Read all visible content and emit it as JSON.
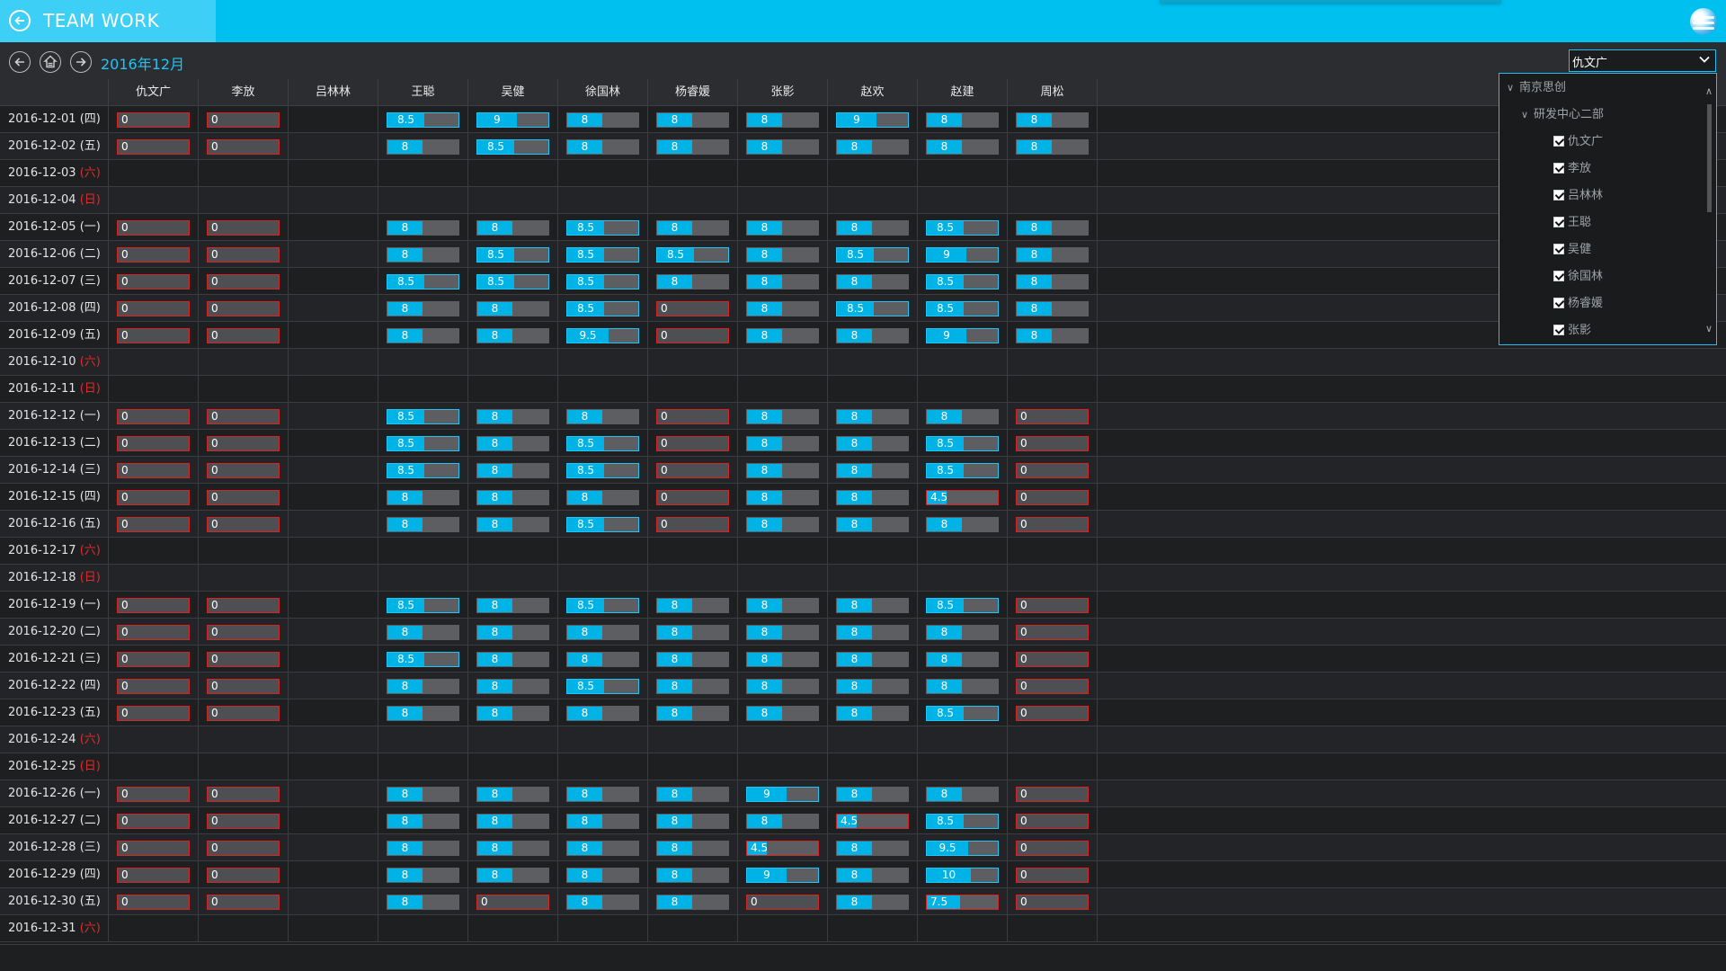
{
  "app": {
    "title": "TEAM WORK"
  },
  "toolbar": {
    "month": "2016年12月",
    "prev_icon": "arrow-left-icon",
    "today_icon": "today-icon",
    "next_icon": "arrow-right-icon"
  },
  "person_select": {
    "value": "仇文广"
  },
  "columns": [
    "仇文广",
    "李放",
    "吕林林",
    "王聪",
    "吴健",
    "徐国林",
    "杨睿媛",
    "张影",
    "赵欢",
    "赵建",
    "周松"
  ],
  "colors": {
    "accent": "#00c0f0",
    "fill": "#00b3e6",
    "weekend": "#e12b2b",
    "alert": "#d42424"
  },
  "rows": [
    {
      "date": "2016-12-01",
      "wk": "(四)",
      "weekend": false,
      "v": [
        "0",
        "0",
        "",
        "8.5",
        "9",
        "8",
        "8",
        "8",
        "9",
        "8",
        "8"
      ]
    },
    {
      "date": "2016-12-02",
      "wk": "(五)",
      "weekend": false,
      "v": [
        "0",
        "0",
        "",
        "8",
        "8.5",
        "8",
        "8",
        "8",
        "8",
        "8",
        "8"
      ]
    },
    {
      "date": "2016-12-03",
      "wk": "(六)",
      "weekend": true,
      "v": [
        "",
        "",
        "",
        "",
        "",
        "",
        "",
        "",
        "",
        "",
        ""
      ]
    },
    {
      "date": "2016-12-04",
      "wk": "(日)",
      "weekend": true,
      "v": [
        "",
        "",
        "",
        "",
        "",
        "",
        "",
        "",
        "",
        "",
        ""
      ]
    },
    {
      "date": "2016-12-05",
      "wk": "(一)",
      "weekend": false,
      "v": [
        "0",
        "0",
        "",
        "8",
        "8",
        "8.5",
        "8",
        "8",
        "8",
        "8.5",
        "8"
      ]
    },
    {
      "date": "2016-12-06",
      "wk": "(二)",
      "weekend": false,
      "v": [
        "0",
        "0",
        "",
        "8",
        "8.5",
        "8.5",
        "8.5",
        "8",
        "8.5",
        "9",
        "8"
      ]
    },
    {
      "date": "2016-12-07",
      "wk": "(三)",
      "weekend": false,
      "v": [
        "0",
        "0",
        "",
        "8.5",
        "8.5",
        "8.5",
        "8",
        "8",
        "8",
        "8.5",
        "8"
      ]
    },
    {
      "date": "2016-12-08",
      "wk": "(四)",
      "weekend": false,
      "v": [
        "0",
        "0",
        "",
        "8",
        "8",
        "8.5",
        "0",
        "8",
        "8.5",
        "8.5",
        "8"
      ]
    },
    {
      "date": "2016-12-09",
      "wk": "(五)",
      "weekend": false,
      "v": [
        "0",
        "0",
        "",
        "8",
        "8",
        "9.5",
        "0",
        "8",
        "8",
        "9",
        "8"
      ]
    },
    {
      "date": "2016-12-10",
      "wk": "(六)",
      "weekend": true,
      "v": [
        "",
        "",
        "",
        "",
        "",
        "",
        "",
        "",
        "",
        "",
        ""
      ]
    },
    {
      "date": "2016-12-11",
      "wk": "(日)",
      "weekend": true,
      "v": [
        "",
        "",
        "",
        "",
        "",
        "",
        "",
        "",
        "",
        "",
        ""
      ]
    },
    {
      "date": "2016-12-12",
      "wk": "(一)",
      "weekend": false,
      "v": [
        "0",
        "0",
        "",
        "8.5",
        "8",
        "8",
        "0",
        "8",
        "8",
        "8",
        "0"
      ]
    },
    {
      "date": "2016-12-13",
      "wk": "(二)",
      "weekend": false,
      "v": [
        "0",
        "0",
        "",
        "8.5",
        "8",
        "8.5",
        "0",
        "8",
        "8",
        "8.5",
        "0"
      ]
    },
    {
      "date": "2016-12-14",
      "wk": "(三)",
      "weekend": false,
      "v": [
        "0",
        "0",
        "",
        "8.5",
        "8",
        "8.5",
        "0",
        "8",
        "8",
        "8.5",
        "0"
      ]
    },
    {
      "date": "2016-12-15",
      "wk": "(四)",
      "weekend": false,
      "v": [
        "0",
        "0",
        "",
        "8",
        "8",
        "8",
        "0",
        "8",
        "8",
        "4.5",
        "0"
      ]
    },
    {
      "date": "2016-12-16",
      "wk": "(五)",
      "weekend": false,
      "v": [
        "0",
        "0",
        "",
        "8",
        "8",
        "8.5",
        "0",
        "8",
        "8",
        "8",
        "0"
      ]
    },
    {
      "date": "2016-12-17",
      "wk": "(六)",
      "weekend": true,
      "v": [
        "",
        "",
        "",
        "",
        "",
        "",
        "",
        "",
        "",
        "",
        ""
      ]
    },
    {
      "date": "2016-12-18",
      "wk": "(日)",
      "weekend": true,
      "v": [
        "",
        "",
        "",
        "",
        "",
        "",
        "",
        "",
        "",
        "",
        ""
      ]
    },
    {
      "date": "2016-12-19",
      "wk": "(一)",
      "weekend": false,
      "v": [
        "0",
        "0",
        "",
        "8.5",
        "8",
        "8.5",
        "8",
        "8",
        "8",
        "8.5",
        "0"
      ]
    },
    {
      "date": "2016-12-20",
      "wk": "(二)",
      "weekend": false,
      "v": [
        "0",
        "0",
        "",
        "8",
        "8",
        "8",
        "8",
        "8",
        "8",
        "8",
        "0"
      ]
    },
    {
      "date": "2016-12-21",
      "wk": "(三)",
      "weekend": false,
      "v": [
        "0",
        "0",
        "",
        "8.5",
        "8",
        "8",
        "8",
        "8",
        "8",
        "8",
        "0"
      ]
    },
    {
      "date": "2016-12-22",
      "wk": "(四)",
      "weekend": false,
      "v": [
        "0",
        "0",
        "",
        "8",
        "8",
        "8.5",
        "8",
        "8",
        "8",
        "8",
        "0"
      ]
    },
    {
      "date": "2016-12-23",
      "wk": "(五)",
      "weekend": false,
      "v": [
        "0",
        "0",
        "",
        "8",
        "8",
        "8",
        "8",
        "8",
        "8",
        "8.5",
        "0"
      ]
    },
    {
      "date": "2016-12-24",
      "wk": "(六)",
      "weekend": true,
      "v": [
        "",
        "",
        "",
        "",
        "",
        "",
        "",
        "",
        "",
        "",
        ""
      ]
    },
    {
      "date": "2016-12-25",
      "wk": "(日)",
      "weekend": true,
      "v": [
        "",
        "",
        "",
        "",
        "",
        "",
        "",
        "",
        "",
        "",
        ""
      ]
    },
    {
      "date": "2016-12-26",
      "wk": "(一)",
      "weekend": false,
      "v": [
        "0",
        "0",
        "",
        "8",
        "8",
        "8",
        "8",
        "9",
        "8",
        "8",
        "0"
      ]
    },
    {
      "date": "2016-12-27",
      "wk": "(二)",
      "weekend": false,
      "v": [
        "0",
        "0",
        "",
        "8",
        "8",
        "8",
        "8",
        "8",
        "4.5",
        "8.5",
        "0"
      ]
    },
    {
      "date": "2016-12-28",
      "wk": "(三)",
      "weekend": false,
      "v": [
        "0",
        "0",
        "",
        "8",
        "8",
        "8",
        "8",
        "4.5",
        "8",
        "9.5",
        "0"
      ]
    },
    {
      "date": "2016-12-29",
      "wk": "(四)",
      "weekend": false,
      "v": [
        "0",
        "0",
        "",
        "8",
        "8",
        "8",
        "8",
        "9",
        "8",
        "10",
        "0"
      ]
    },
    {
      "date": "2016-12-30",
      "wk": "(五)",
      "weekend": false,
      "v": [
        "0",
        "0",
        "",
        "8",
        "0",
        "8",
        "8",
        "0",
        "8",
        "7.5",
        "0"
      ]
    },
    {
      "date": "2016-12-31",
      "wk": "(六)",
      "weekend": true,
      "v": [
        "",
        "",
        "",
        "",
        "",
        "",
        "",
        "",
        "",
        "",
        ""
      ]
    }
  ],
  "tree": {
    "root": "南京思创",
    "group": "研发中心二部",
    "members": [
      "仇文广",
      "李放",
      "吕林林",
      "王聪",
      "吴健",
      "徐国林",
      "杨睿媛",
      "张影"
    ]
  }
}
